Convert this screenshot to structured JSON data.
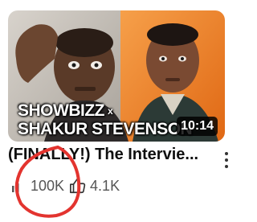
{
  "video": {
    "thumbnail": {
      "caption_line1": "SHOWBIZZ",
      "caption_x": "x",
      "caption_line2": "SHAKUR STEVENSON",
      "duration": "10:14"
    },
    "title": "(FINALLY!) The Intervie...",
    "views": "100K",
    "likes": "4.1K",
    "icons": {
      "views": "bar-chart-icon",
      "likes": "thumbs-up-icon",
      "more": "more-vert-icon"
    }
  },
  "colors": {
    "annotation_circle": "#e3342f",
    "thumbnail_left_bg": "#c9c4bd",
    "thumbnail_right_bg": "#f07a1a"
  }
}
